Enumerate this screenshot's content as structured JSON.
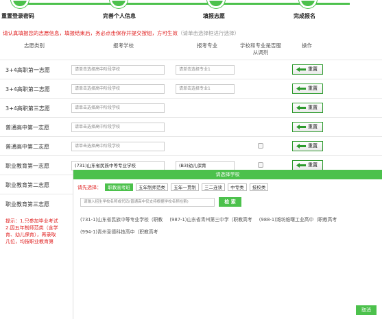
{
  "steps": [
    {
      "label": "重置登录密码"
    },
    {
      "label": "完善个人信息"
    },
    {
      "label": "填报志愿"
    },
    {
      "label": "完成报名"
    }
  ],
  "notice": {
    "text": "请认真填报您的志愿信息，填报结束后，务必点击保存并提交按钮，方可生效",
    "hint": "（请单击选择框进行选择）"
  },
  "table": {
    "headers": {
      "category": "志愿类别",
      "school": "报考学校",
      "major": "报考专业",
      "adjust_line1": "学校和专业是否服",
      "adjust_line2": "从调剂",
      "action": "操作"
    },
    "rows": [
      {
        "name": "3+4高职第一志愿",
        "school": "请单击选择高中阶段学校",
        "major": "请单击选择专业1",
        "reset": "重置"
      },
      {
        "name": "3+4高职第二志愿",
        "school": "请单击选择高中阶段学校",
        "major": "请单击选择专业1",
        "reset": "重置"
      },
      {
        "name": "3+4高职第三志愿",
        "school": "请单击选择高中阶段学校",
        "reset": "重置"
      },
      {
        "name": "普通高中第一志愿",
        "school": "请单击选择高中阶段学校",
        "reset": "重置"
      },
      {
        "name": "普通高中第二志愿",
        "school": "请单击选择高中阶段学校",
        "reset": "重置"
      },
      {
        "name": "职业教育第一志愿",
        "school": "(731)山东省民族中等专业学校",
        "major": "(B3)幼儿保育",
        "reset": "重置"
      },
      {
        "name": "职业教育第二志愿"
      },
      {
        "name": "职业教育第三志愿"
      }
    ]
  },
  "tips": {
    "line1": "提示：1.只参加毕业考试",
    "line2": "2.因五年制师范类（含学",
    "line3": "育、幼儿保育），再录取",
    "line4": "几位，均按职业教育第"
  },
  "modal": {
    "title": "请选择学校",
    "filter_label": "请先选择：",
    "filters": [
      "职教高考班",
      "五年制师范类",
      "五年一贯制",
      "三二连读",
      "中专类",
      "技校类"
    ],
    "search_placeholder": "请输入招生学校名称或代码(普通高中仅支持根据学校名称检索)",
    "search_button": "检 索",
    "results": [
      "(731-1)山东省民族中等专业学校（职教",
      "(987-1)山东省青州第三中学（职教高考",
      "(988-1)潍坊维曙工业高中（职教高考",
      "(994-1)青州圣德科技高中（职教高考"
    ],
    "cancel_button": "取消"
  },
  "colors": {
    "accent": "#4cc14c",
    "warning": "#e02020"
  }
}
